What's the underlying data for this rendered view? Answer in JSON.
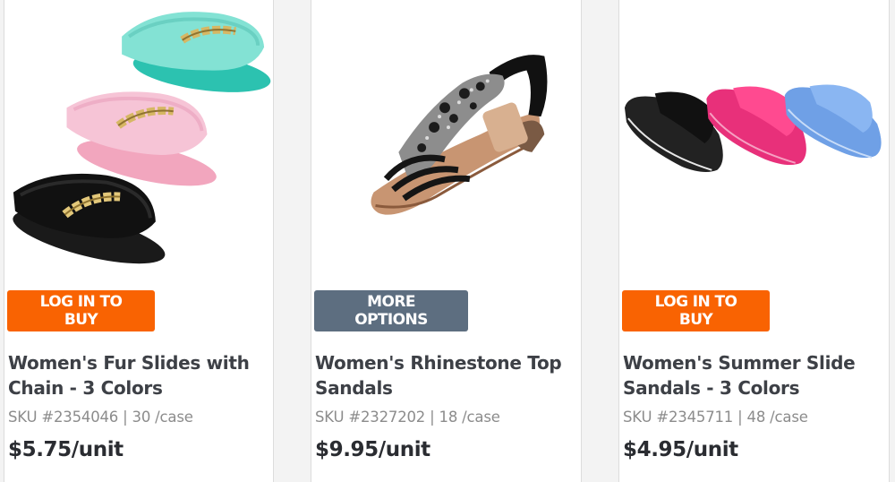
{
  "products": [
    {
      "image_alt": "",
      "button_label": "LOG IN TO BUY",
      "title": "Women's Fur Slides with Chain - 3 Colors",
      "sku": "SKU #2354046 | 30 /case",
      "price": "$5.75/unit"
    },
    {
      "image_alt": "",
      "button_label": "MORE OPTIONS",
      "title": "Women's Rhinestone Top Sandals",
      "sku": "SKU #2327202 | 18 /case",
      "price": "$9.95/unit"
    },
    {
      "image_alt": "",
      "button_label": "LOG IN TO BUY",
      "title": "Women's Summer Slide Sandals - 3 Colors",
      "sku": "SKU #2345711 | 48 /case",
      "price": "$4.95/unit"
    }
  ],
  "colors": {
    "primary_button": "#f96302",
    "secondary_button": "#5d6e80",
    "title_text": "#3d4046",
    "sku_text": "#8c8c8c",
    "price_text": "#2a2c31"
  }
}
